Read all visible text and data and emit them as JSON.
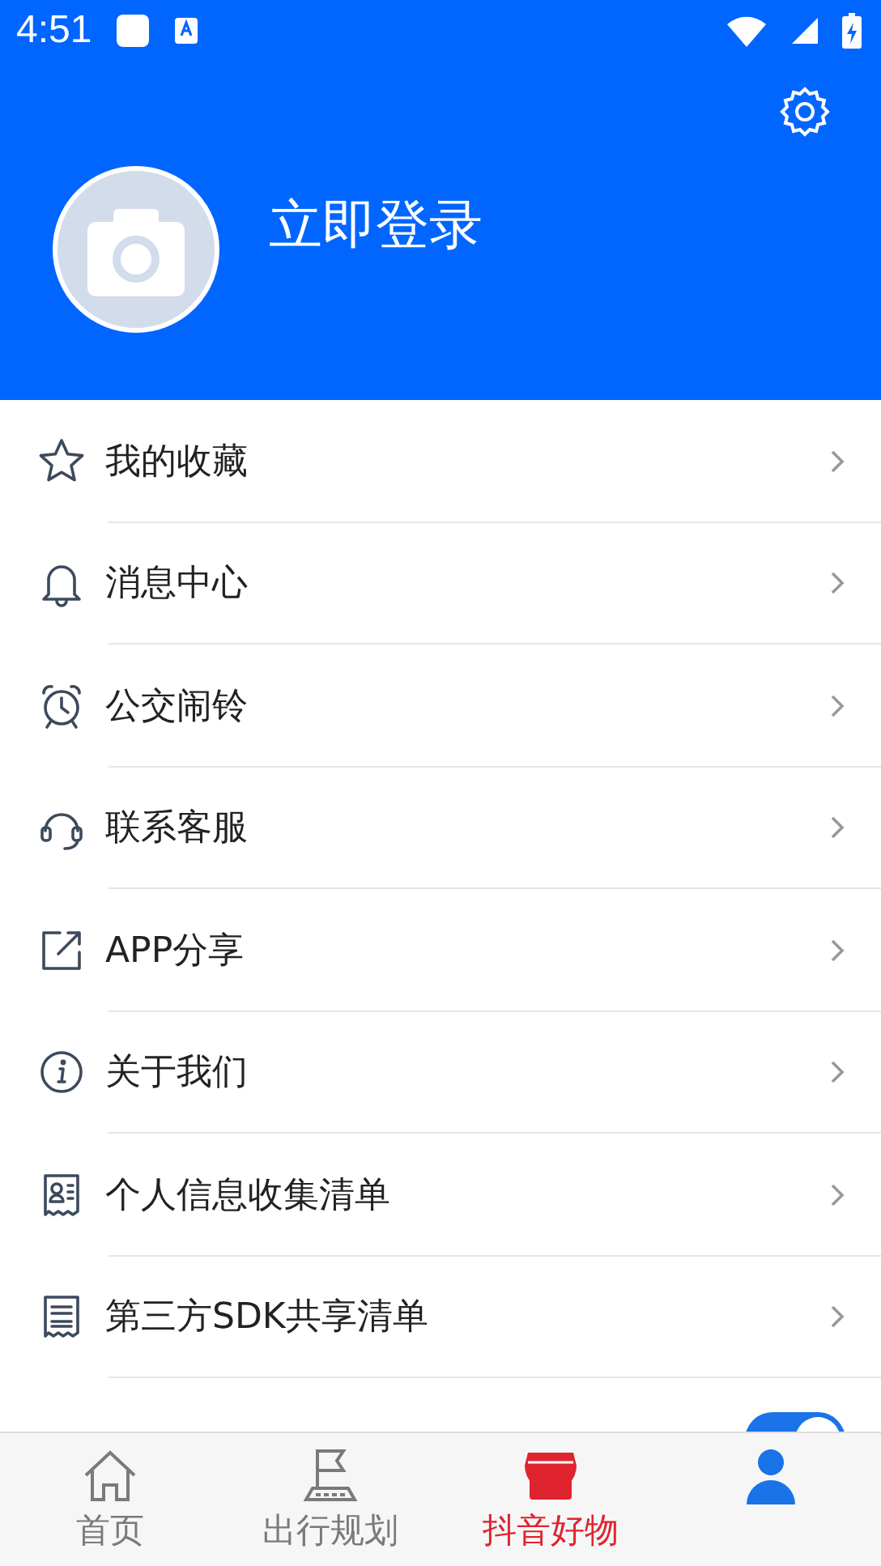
{
  "status_bar": {
    "time": "4:51"
  },
  "header": {
    "login_label": "立即登录"
  },
  "menu": [
    {
      "label": "我的收藏",
      "kind": "link"
    },
    {
      "label": "消息中心",
      "kind": "link"
    },
    {
      "label": "公交闹铃",
      "kind": "link"
    },
    {
      "label": "联系客服",
      "kind": "link"
    },
    {
      "label": "APP分享",
      "kind": "link"
    },
    {
      "label": "关于我们",
      "kind": "link"
    },
    {
      "label": "个人信息收集清单",
      "kind": "link"
    },
    {
      "label": "第三方SDK共享清单",
      "kind": "link"
    },
    {
      "kind": "toggle",
      "on": true
    }
  ],
  "tabs": [
    {
      "label": "首页",
      "selected": false,
      "kind": "normal"
    },
    {
      "label": "出行规划",
      "selected": false,
      "kind": "normal"
    },
    {
      "label": "抖音好物",
      "selected": false,
      "kind": "promo"
    },
    {
      "selected": true,
      "kind": "normal"
    }
  ]
}
